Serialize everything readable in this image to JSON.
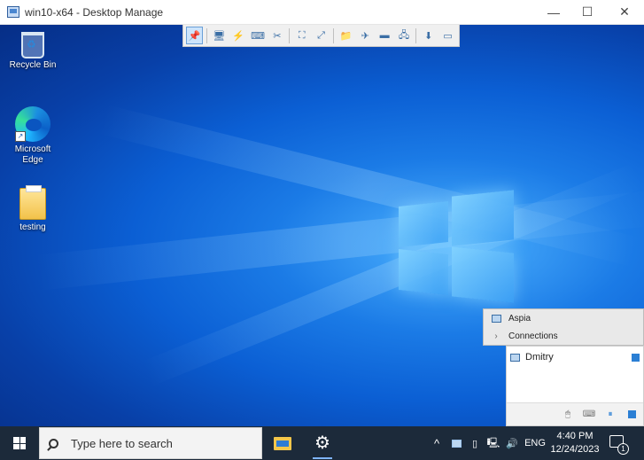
{
  "window": {
    "title": "win10-x64 - Desktop Manage",
    "minimize_glyph": "—",
    "maximize_glyph": "☐",
    "close_glyph": "✕"
  },
  "desktop_icons": [
    {
      "label": "Recycle Bin",
      "icon": "recycle-bin-icon"
    },
    {
      "label": "Microsoft Edge",
      "icon": "edge-icon"
    },
    {
      "label": "testing",
      "icon": "folder-icon"
    }
  ],
  "remote_toolbar": {
    "buttons": [
      {
        "name": "pin",
        "glyph": "📌"
      },
      {
        "name": "monitor",
        "glyph": "🖥"
      },
      {
        "name": "power",
        "glyph": "⚡"
      },
      {
        "name": "keyboard",
        "glyph": "⌨"
      },
      {
        "name": "tools",
        "glyph": "✂"
      },
      {
        "name": "autosize",
        "glyph": "⛶"
      },
      {
        "name": "fullscreen",
        "glyph": "⤢"
      },
      {
        "name": "file-transfer",
        "glyph": "📁"
      },
      {
        "name": "send",
        "glyph": "✈"
      },
      {
        "name": "terminal",
        "glyph": "▬"
      },
      {
        "name": "system-info",
        "glyph": "🖧"
      },
      {
        "name": "screenshot",
        "glyph": "⬇"
      },
      {
        "name": "minimize-toolbar",
        "glyph": "▭"
      }
    ]
  },
  "panel": {
    "menu": [
      {
        "label": "Aspia"
      },
      {
        "label": "Connections",
        "glyph": "›"
      }
    ],
    "user": "Dmitry",
    "footer": {
      "mouse_glyph": "🖱",
      "keyboard_glyph": "⌨",
      "pause_glyph": "⏸"
    }
  },
  "taskbar": {
    "search_placeholder": "Type here to search",
    "tray": {
      "chevron": "^",
      "lang": "ENG",
      "volume_glyph": "🔊",
      "network_glyph": "🖳"
    },
    "time": "4:40 PM",
    "date": "12/24/2023",
    "notification_count": "1"
  },
  "colors": {
    "taskbar": "#1c2a3a",
    "accent": "#2b7fd4"
  }
}
